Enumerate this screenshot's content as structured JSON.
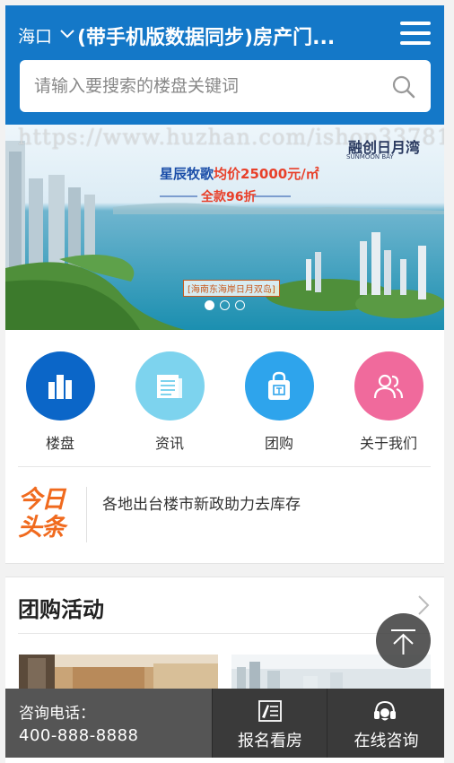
{
  "header": {
    "city": "海口",
    "title": "(带手机版数据同步)房产门...",
    "search_placeholder": "请输入要搜索的楼盘关键词"
  },
  "banner": {
    "watermark": "https://www.huzhan.com/ishop33781",
    "brand": "融创日月湾",
    "brand_sub": "SUNMOON BAY",
    "slogan_prefix": "星辰牧歌",
    "slogan_price": "均价25000元/㎡",
    "discount": "全款96折",
    "location_tag": "[海南东海岸日月双岛]",
    "slide_count": 3,
    "active_slide": 1
  },
  "nav": [
    {
      "label": "楼盘",
      "color": "#0b66c8",
      "icon": "buildings-icon"
    },
    {
      "label": "资讯",
      "color": "#7dd3ee",
      "icon": "news-icon"
    },
    {
      "label": "团购",
      "color": "#2ea4ec",
      "icon": "shopping-bag-icon"
    },
    {
      "label": "关于我们",
      "color": "#f06a9c",
      "icon": "users-icon"
    }
  ],
  "headline": {
    "logo_line1": "今日",
    "logo_line2": "头条",
    "text": "各地出台楼市新政助力去库存"
  },
  "section": {
    "title": "团购活动"
  },
  "footer": {
    "phone_label": "咨询电话：",
    "phone_number": "400-888-8888",
    "signup_label": "报名看房",
    "consult_label": "在线咨询"
  },
  "colors": {
    "header_bg": "#1478c8",
    "accent_orange": "#f06a1e",
    "footer_bg": "#3a3a3a"
  }
}
